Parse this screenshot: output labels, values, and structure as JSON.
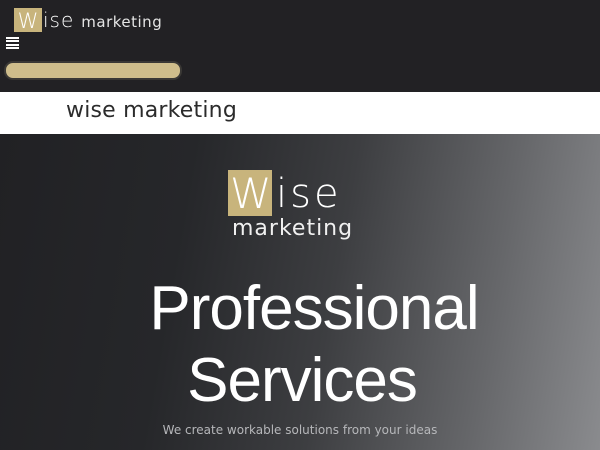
{
  "header": {
    "logo": {
      "initial": "W",
      "rest": "ise",
      "word": "marketing"
    },
    "menu_icon": "hamburger-menu-icon",
    "search": {
      "placeholder": ""
    }
  },
  "site_title": "wise marketing",
  "hero": {
    "logo": {
      "initial": "W",
      "rest": "ise",
      "word": "marketing"
    },
    "headline_line1": "Professional",
    "headline_line2": "Services",
    "tagline": "We create workable solutions from your ideas"
  },
  "colors": {
    "accent": "#c8b47c",
    "header_bg": "#222124",
    "search_pill": "#cfbd8b",
    "title_strip_bg": "#ffffff"
  }
}
